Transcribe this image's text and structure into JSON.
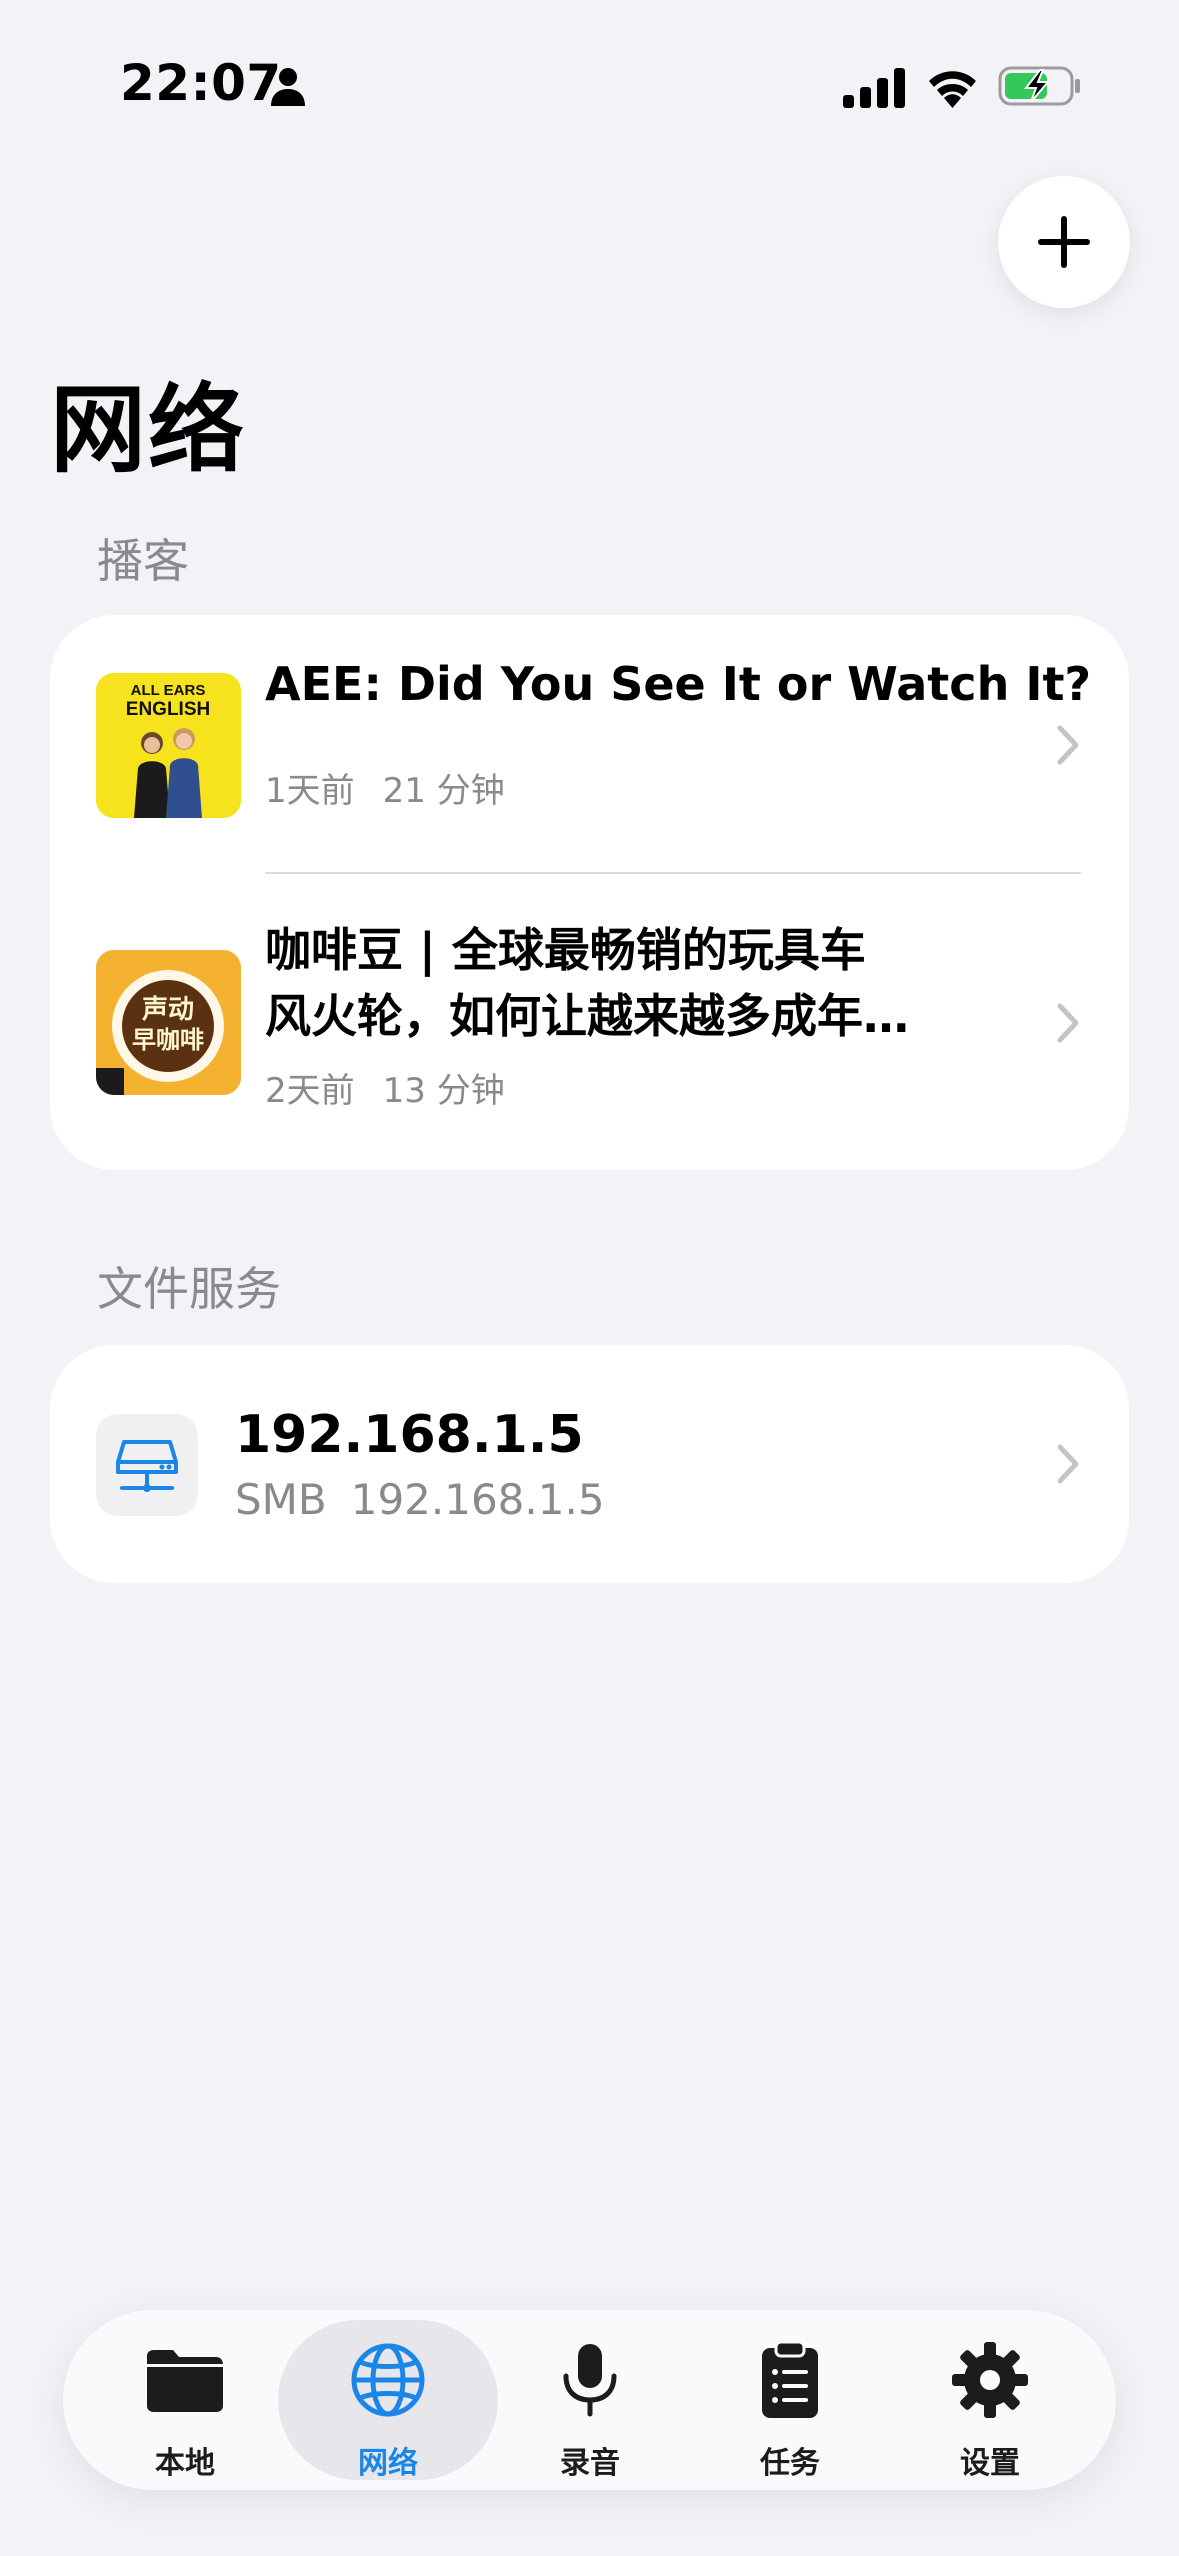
{
  "status_bar": {
    "time": "22:07"
  },
  "header": {
    "title": "网络"
  },
  "sections": {
    "podcast": {
      "header": "播客",
      "items": [
        {
          "title": "AEE: Did You See It or Watch It?",
          "ago": "1天前",
          "duration": "21 分钟",
          "artwork_text": [
            "ALL EARS",
            "ENGLISH"
          ]
        },
        {
          "title_line1": "咖啡豆 | 全球最畅销的玩具车",
          "title_line2": "风火轮，如何让越来越多成年…",
          "ago": "2天前",
          "duration": "13 分钟",
          "artwork_text": [
            "声动",
            "早咖啡"
          ]
        }
      ]
    },
    "file_service": {
      "header": "文件服务",
      "items": [
        {
          "name": "192.168.1.5",
          "protocol": "SMB",
          "address": "192.168.1.5"
        }
      ]
    }
  },
  "tab_bar": {
    "tabs": [
      {
        "label": "本地",
        "icon": "folder-icon"
      },
      {
        "label": "网络",
        "icon": "globe-icon",
        "active": true
      },
      {
        "label": "录音",
        "icon": "microphone-icon"
      },
      {
        "label": "任务",
        "icon": "clipboard-icon"
      },
      {
        "label": "设置",
        "icon": "gear-icon"
      }
    ]
  },
  "colors": {
    "background": "#f2f2f7",
    "accent": "#1a86e8",
    "secondary_text": "#8a8a8e",
    "battery_charging": "#34c759"
  }
}
